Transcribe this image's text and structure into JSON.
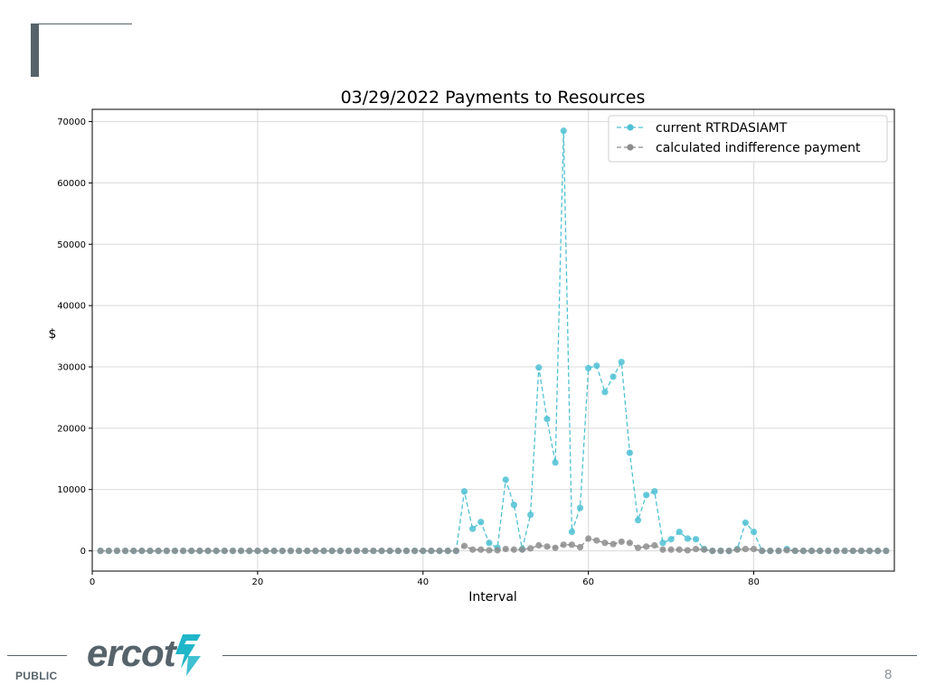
{
  "slide": {
    "footer_label": "PUBLIC",
    "page_number": "8",
    "logo_text": "ercot",
    "colors": {
      "accent_gray": "#56636a",
      "logo_teal": "#1fb6c9"
    }
  },
  "chart_data": {
    "type": "line",
    "title": "03/29/2022 Payments to Resources",
    "xlabel": "Interval",
    "ylabel": "$",
    "xlim": [
      0,
      97
    ],
    "ylim": [
      -3300,
      72000
    ],
    "xticks": [
      0,
      20,
      40,
      60,
      80
    ],
    "yticks": [
      0,
      10000,
      20000,
      30000,
      40000,
      50000,
      60000,
      70000
    ],
    "grid": true,
    "legend_position": "top-right",
    "x": [
      1,
      2,
      3,
      4,
      5,
      6,
      7,
      8,
      9,
      10,
      11,
      12,
      13,
      14,
      15,
      16,
      17,
      18,
      19,
      20,
      21,
      22,
      23,
      24,
      25,
      26,
      27,
      28,
      29,
      30,
      31,
      32,
      33,
      34,
      35,
      36,
      37,
      38,
      39,
      40,
      41,
      42,
      43,
      44,
      45,
      46,
      47,
      48,
      49,
      50,
      51,
      52,
      53,
      54,
      55,
      56,
      57,
      58,
      59,
      60,
      61,
      62,
      63,
      64,
      65,
      66,
      67,
      68,
      69,
      70,
      71,
      72,
      73,
      74,
      75,
      76,
      77,
      78,
      79,
      80,
      81,
      82,
      83,
      84,
      85,
      86,
      87,
      88,
      89,
      90,
      91,
      92,
      93,
      94,
      95,
      96
    ],
    "series": [
      {
        "name": "current RTRDASIAMT",
        "color": "#4fc1d3",
        "values": [
          0,
          0,
          0,
          0,
          0,
          0,
          0,
          0,
          0,
          0,
          0,
          0,
          0,
          0,
          0,
          0,
          0,
          0,
          0,
          0,
          0,
          0,
          0,
          0,
          0,
          0,
          0,
          0,
          0,
          0,
          0,
          0,
          0,
          0,
          0,
          0,
          0,
          0,
          0,
          0,
          0,
          0,
          0,
          0,
          9700,
          3600,
          4700,
          1300,
          500,
          11600,
          7500,
          300,
          5900,
          29900,
          21500,
          14400,
          68500,
          3100,
          7000,
          29800,
          30200,
          25900,
          28400,
          30800,
          16000,
          5000,
          9100,
          9700,
          1300,
          1900,
          3100,
          2000,
          1900,
          300,
          0,
          0,
          0,
          300,
          4600,
          3100,
          0,
          0,
          0,
          300,
          0,
          0,
          0,
          0,
          0,
          0,
          0,
          0,
          0,
          0,
          0,
          0
        ]
      },
      {
        "name": "calculated indifference payment",
        "color": "#8d8d8d",
        "values": [
          0,
          0,
          0,
          0,
          0,
          0,
          0,
          0,
          0,
          0,
          0,
          0,
          0,
          0,
          0,
          0,
          0,
          0,
          0,
          0,
          0,
          0,
          0,
          0,
          0,
          0,
          0,
          0,
          0,
          0,
          0,
          0,
          0,
          0,
          0,
          0,
          0,
          0,
          0,
          0,
          0,
          0,
          0,
          0,
          800,
          200,
          200,
          100,
          100,
          300,
          200,
          200,
          400,
          900,
          700,
          500,
          1000,
          1000,
          600,
          2000,
          1700,
          1300,
          1100,
          1500,
          1300,
          500,
          700,
          900,
          200,
          200,
          200,
          100,
          300,
          200,
          0,
          0,
          0,
          200,
          300,
          300,
          0,
          0,
          0,
          100,
          0,
          0,
          0,
          0,
          0,
          0,
          0,
          0,
          0,
          0,
          0,
          0
        ]
      }
    ]
  }
}
